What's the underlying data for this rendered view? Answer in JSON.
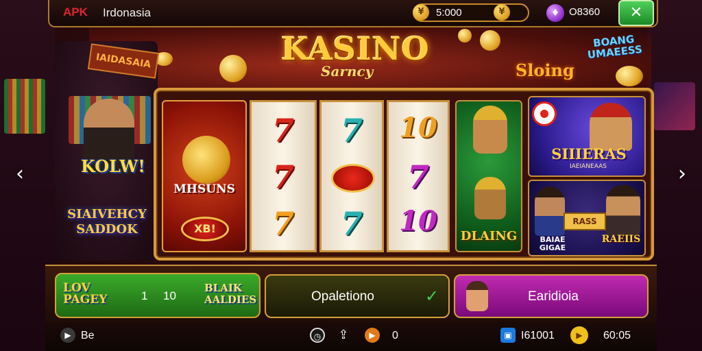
{
  "topbar": {
    "brand": "APK",
    "brand_sub": "Irdonasia",
    "coin_value": "5:000",
    "gem_value": "O8360",
    "close_label": "✕"
  },
  "marquee": {
    "title": "KASINO",
    "subtitle": "Sarncy",
    "slot_label": "Sloing",
    "bonus_label": "BOANG UMAEESS",
    "sign_label": "IAIDASAIA"
  },
  "left_panel": {
    "headline": "KOLW!",
    "logo_text": "SIAIVEHCY SADDOK"
  },
  "reels": {
    "feature_card": {
      "title": "MHSUNS",
      "badge": "XB!"
    },
    "columns": [
      [
        "7",
        "7",
        "7"
      ],
      [
        "7",
        "",
        "7"
      ],
      [
        "10",
        "7",
        "10"
      ]
    ],
    "green_card_label": "DLAING"
  },
  "promo_cards": {
    "blue": {
      "title": "SIIIERAS",
      "subtitle": "IAEIANEAAS"
    },
    "purple": {
      "ticket": "RASS",
      "left_label": "BAIAE GIGAE",
      "right_label": "RAEIIS"
    }
  },
  "bottom_panels": {
    "green": {
      "logo_left": "LOV PAGEY",
      "num1": "1",
      "num2": "10",
      "logo_right": "BLAIK AALDIES"
    },
    "dark": {
      "label": "Opaletiono",
      "icon": "✓"
    },
    "purple": {
      "label": "Earidioia"
    }
  },
  "footer": {
    "left_label": "Be",
    "center_value": "0",
    "right_value": "I61001",
    "time_value": "60:05"
  },
  "colors": {
    "accent_gold": "#d79a3a",
    "close_green": "#1c8a26",
    "panel_purple": "#c02ab0",
    "panel_green": "#3aaa2a"
  }
}
